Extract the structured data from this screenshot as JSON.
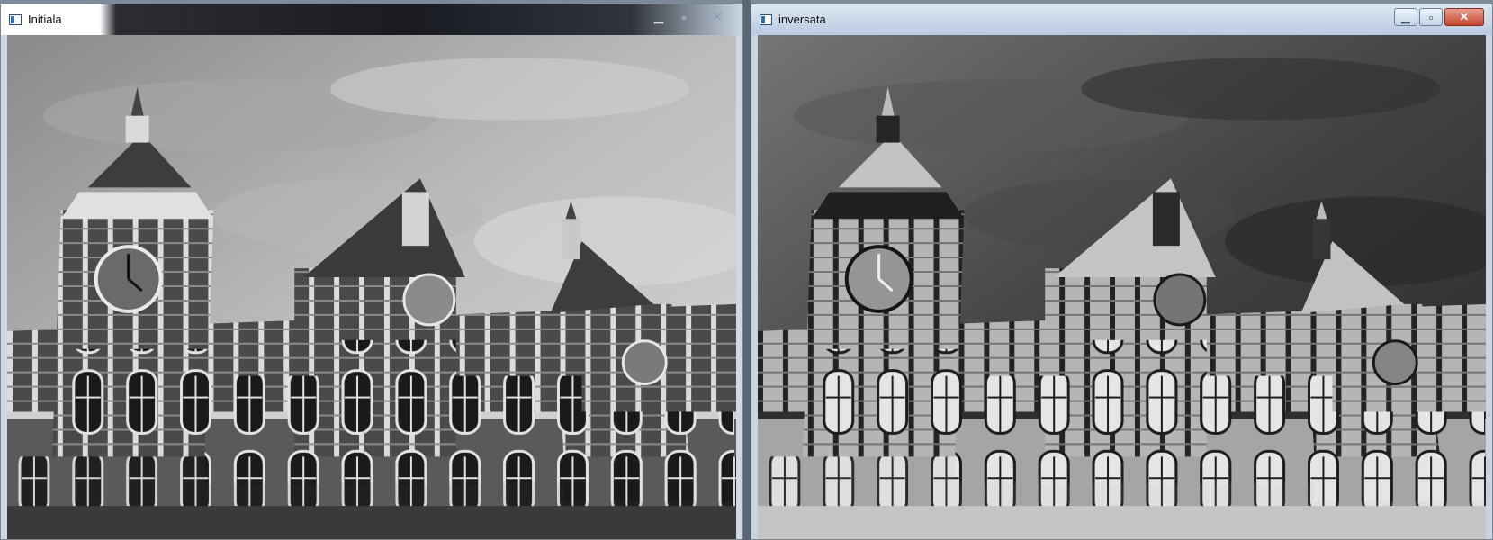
{
  "windows": [
    {
      "title": "Initiala",
      "controls": {
        "minimize": "▁",
        "maximize": "▫",
        "close": "✕"
      }
    },
    {
      "title": "inversata",
      "controls": {
        "minimize": "▁",
        "maximize": "▫",
        "close": "✕"
      }
    }
  ]
}
